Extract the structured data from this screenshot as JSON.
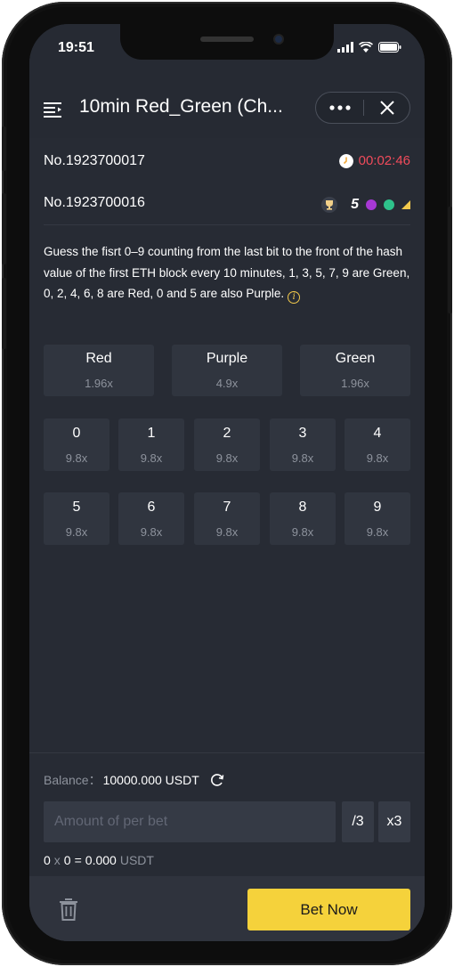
{
  "status_bar": {
    "time": "19:51"
  },
  "header": {
    "title": "10min Red_Green (Ch...",
    "icons": {
      "menu": "menu-icon",
      "more": "more-icon",
      "close": "close-icon"
    }
  },
  "current_issue": {
    "number": "No.1923700017",
    "countdown": "00:02:46"
  },
  "previous_issue": {
    "number": "No.1923700016",
    "result_number": "5",
    "result_colors": [
      "#a738d4",
      "#2ec28b"
    ]
  },
  "description": {
    "text": "Guess the fisrt 0–9 counting from the last bit to the front of the hash value of the first ETH block every 10 minutes, 1, 3, 5, 7, 9 are Green, 0, 2, 4, 6, 8 are Red, 0 and 5 are also Purple."
  },
  "color_options": [
    {
      "label": "Red",
      "odds": "1.96x"
    },
    {
      "label": "Purple",
      "odds": "4.9x"
    },
    {
      "label": "Green",
      "odds": "1.96x"
    }
  ],
  "number_options": [
    {
      "label": "0",
      "odds": "9.8x"
    },
    {
      "label": "1",
      "odds": "9.8x"
    },
    {
      "label": "2",
      "odds": "9.8x"
    },
    {
      "label": "3",
      "odds": "9.8x"
    },
    {
      "label": "4",
      "odds": "9.8x"
    },
    {
      "label": "5",
      "odds": "9.8x"
    },
    {
      "label": "6",
      "odds": "9.8x"
    },
    {
      "label": "7",
      "odds": "9.8x"
    },
    {
      "label": "8",
      "odds": "9.8x"
    },
    {
      "label": "9",
      "odds": "9.8x"
    }
  ],
  "bet_panel": {
    "balance_label": "Balance：",
    "balance_value": "10000.000 USDT",
    "amount_placeholder": "Amount of per bet",
    "divide_label": "/3",
    "multiply_label": "x3",
    "calc": {
      "amount": "0",
      "times_sign": "x",
      "count": "0",
      "equals": "=",
      "total": "0.000",
      "unit": "USDT"
    },
    "bet_button": "Bet Now"
  },
  "colors": {
    "background": "#272b34",
    "tile": "#30353f",
    "accent": "#f5d23b",
    "timer": "#f04b5b"
  }
}
